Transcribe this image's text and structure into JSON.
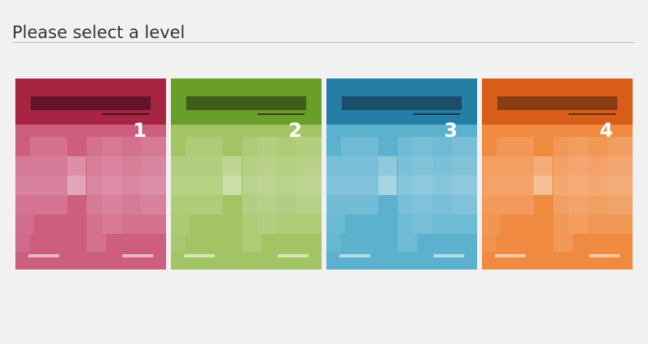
{
  "page": {
    "title": "Please select a level"
  },
  "levels": [
    {
      "number": "1",
      "colors": {
        "top": "#a72543",
        "bar": "#64142a",
        "line": "#4a1020",
        "body": "#cd5e80"
      }
    },
    {
      "number": "2",
      "colors": {
        "top": "#6a9e2b",
        "bar": "#3f5e1a",
        "line": "#2d4512",
        "body": "#a3c464"
      }
    },
    {
      "number": "3",
      "colors": {
        "top": "#257ea6",
        "bar": "#1a4d68",
        "line": "#133a4e",
        "body": "#5cb1cf"
      }
    },
    {
      "number": "4",
      "colors": {
        "top": "#d85d1a",
        "bar": "#8a3c12",
        "line": "#6a2c0c",
        "body": "#f08a40"
      }
    }
  ]
}
